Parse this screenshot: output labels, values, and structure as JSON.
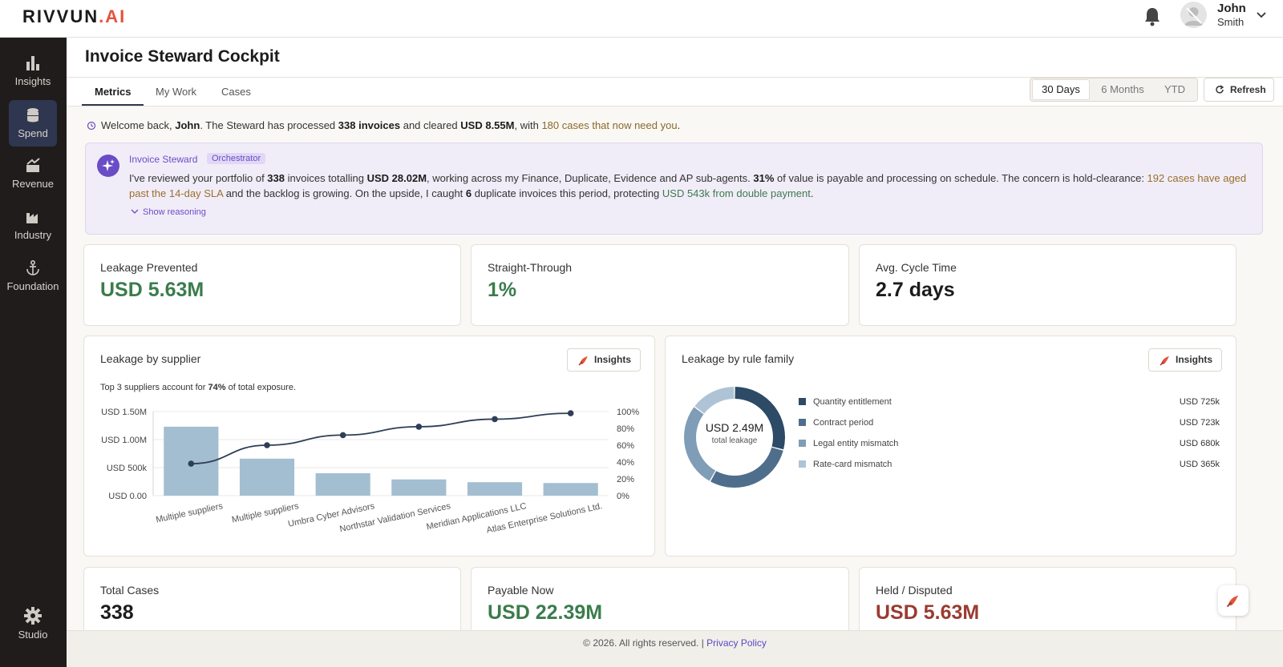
{
  "brand": {
    "name": "RIVVUN",
    "suffix": ".AI"
  },
  "user": {
    "first": "John",
    "last": "Smith"
  },
  "sidebar": {
    "items": [
      {
        "label": "Insights",
        "icon": "bar-chart-icon",
        "active": false
      },
      {
        "label": "Spend",
        "icon": "database-icon",
        "active": true
      },
      {
        "label": "Revenue",
        "icon": "revenue-icon",
        "active": false
      },
      {
        "label": "Industry",
        "icon": "factory-icon",
        "active": false
      },
      {
        "label": "Foundation",
        "icon": "anchor-icon",
        "active": false
      }
    ],
    "studio": "Studio"
  },
  "page": {
    "title": "Invoice Steward Cockpit"
  },
  "tabs": [
    {
      "label": "Metrics",
      "active": true
    },
    {
      "label": "My Work",
      "active": false
    },
    {
      "label": "Cases",
      "active": false
    }
  ],
  "ranges": [
    {
      "label": "30 Days",
      "active": true
    },
    {
      "label": "6 Months",
      "active": false
    },
    {
      "label": "YTD",
      "active": false
    }
  ],
  "refresh_label": "Refresh",
  "welcome": {
    "p1": "Welcome back, ",
    "name": "John",
    "p2": ". The Steward has processed ",
    "invoices": "338 invoices",
    "p3": " and cleared ",
    "cleared": "USD 8.55M",
    "p4": ", with ",
    "cases": "180 cases that now need you",
    "p5": "."
  },
  "steward": {
    "name": "Invoice Steward",
    "badge": "Orchestrator",
    "t1": "I've reviewed your portfolio of ",
    "b1": "338",
    "t2": " invoices totalling ",
    "b2": "USD 28.02M",
    "t3": ", working across my Finance, Duplicate, Evidence and AP sub-agents. ",
    "b3": "31%",
    "t4": " of value is payable and processing on schedule. The concern is hold-clearance: ",
    "w1": "192 cases have aged past the 14-day SLA",
    "t5": " and the backlog is growing. On the upside, I caught ",
    "b4": "6",
    "t6": " duplicate invoices this period, protecting ",
    "g1": "USD 543k from double payment",
    "t7": ".",
    "show_reasoning": "Show reasoning"
  },
  "kpis_top": [
    {
      "label": "Leakage Prevented",
      "value": "USD 5.63M",
      "tone": "green"
    },
    {
      "label": "Straight-Through",
      "value": "1%",
      "tone": "green"
    },
    {
      "label": "Avg. Cycle Time",
      "value": "2.7 days",
      "tone": "dark"
    }
  ],
  "kpis_bottom": [
    {
      "label": "Total Cases",
      "value": "338",
      "tone": "dark"
    },
    {
      "label": "Payable Now",
      "value": "USD 22.39M",
      "tone": "green"
    },
    {
      "label": "Held / Disputed",
      "value": "USD 5.63M",
      "tone": "red"
    }
  ],
  "supplier_card": {
    "title": "Leakage by supplier",
    "insights_label": "Insights",
    "note_pre": "Top 3 suppliers account for ",
    "note_bold": "74%",
    "note_post": " of total exposure."
  },
  "rule_card": {
    "title": "Leakage by rule family",
    "insights_label": "Insights",
    "center_value": "USD 2.49M",
    "center_label": "total leakage"
  },
  "chart_data": [
    {
      "type": "bar",
      "categories": [
        "Multiple suppliers",
        "Multiple suppliers",
        "Umbra Cyber Advisors",
        "Northstar Validation Services",
        "Meridian Applications LLC",
        "Atlas Enterprise Solutions Ltd."
      ],
      "series": [
        {
          "type": "bar",
          "values": [
            1230000,
            660000,
            400000,
            290000,
            240000,
            225000
          ],
          "color": "#a4bed1"
        },
        {
          "type": "line",
          "axis": "right",
          "values": [
            38,
            60,
            72,
            82,
            91,
            98
          ],
          "color": "#2d3e57"
        }
      ],
      "yticks_left": [
        "USD 0.00",
        "USD 500k",
        "USD 1.00M",
        "USD 1.50M"
      ],
      "ylim_left": [
        0,
        1500000
      ],
      "yticks_right": [
        "0%",
        "20%",
        "40%",
        "60%",
        "80%",
        "100%"
      ],
      "ylim_right": [
        0,
        100
      ],
      "grid": true
    },
    {
      "type": "pie",
      "labels": [
        "Quantity entitlement",
        "Contract period",
        "Legal entity mismatch",
        "Rate-card mismatch"
      ],
      "values": [
        725,
        723,
        680,
        365
      ],
      "display_values": [
        "USD 725k",
        "USD 723k",
        "USD 680k",
        "USD 365k"
      ],
      "colors": [
        "#2d4a66",
        "#4f6e8c",
        "#7f9db6",
        "#aec4d6"
      ],
      "legend": "right"
    }
  ],
  "footer": {
    "text": "© 2026. All rights reserved. | ",
    "link": "Privacy Policy"
  }
}
